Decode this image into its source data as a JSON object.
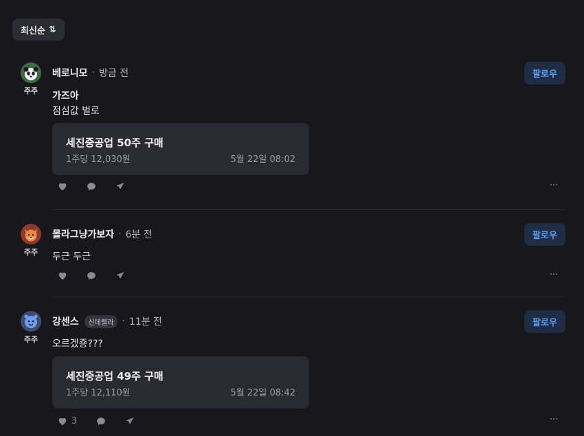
{
  "sort": {
    "label": "최신순",
    "icon": "sort-arrows-icon"
  },
  "badge_label": "주주",
  "follow_label": "팔로우",
  "more_label": "···",
  "posts": [
    {
      "username": "베로니모",
      "time": "방금 전",
      "avatar": {
        "icon": "panda-icon",
        "bg": "#3e6b45"
      },
      "title": "가즈아",
      "body": "점심값 벌로",
      "trade": {
        "title": "세진중공업 50주 구매",
        "price": "1주당 12,030원",
        "date": "5월 22일 08:02"
      },
      "likes": ""
    },
    {
      "username": "몰라그냥가보자",
      "time": "6분 전",
      "avatar": {
        "icon": "fox-icon",
        "bg": "#8a3a2e"
      },
      "body": "두근 두근",
      "likes": ""
    },
    {
      "username": "강센스",
      "tag": "신데렐라",
      "time": "11분 전",
      "avatar": {
        "icon": "blue-creature-icon",
        "bg": "#3e4f6e"
      },
      "body": "오르겠죵???",
      "trade": {
        "title": "세진중공업 49주 구매",
        "price": "1주당 12,110원",
        "date": "5월 22일 08:42"
      },
      "likes": "3"
    }
  ],
  "colors": {
    "background": "#17171c",
    "follow_text": "#5d9cf5",
    "follow_bg": "#1e2c44",
    "card_bg": "#2a2a32"
  }
}
